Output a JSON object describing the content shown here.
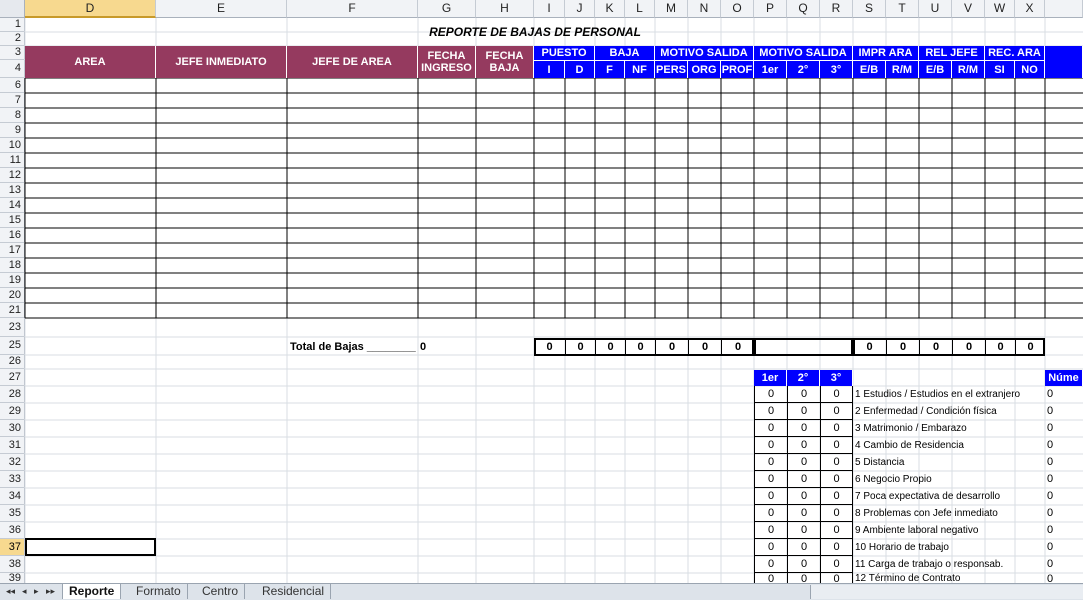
{
  "report_title": "REPORTE DE BAJAS DE PERSONAL",
  "columns": [
    "D",
    "E",
    "F",
    "G",
    "H",
    "I",
    "J",
    "K",
    "L",
    "M",
    "N",
    "O",
    "P",
    "Q",
    "R",
    "S",
    "T",
    "U",
    "V",
    "W",
    "X"
  ],
  "selected_column": "D",
  "rows": [
    "1",
    "2",
    "3",
    "4",
    "6",
    "7",
    "8",
    "9",
    "10",
    "11",
    "12",
    "13",
    "14",
    "15",
    "16",
    "17",
    "18",
    "19",
    "20",
    "21",
    "23",
    "25",
    "26",
    "27",
    "28",
    "29",
    "30",
    "31",
    "32",
    "33",
    "34",
    "35",
    "36",
    "37",
    "38",
    "39"
  ],
  "selected_row": "37",
  "headers": {
    "area": "AREA",
    "jefe_inmediato": "JEFE INMEDIATO",
    "jefe_de_area": "JEFE DE AREA",
    "fecha_ingreso": "FECHA INGRESO",
    "fecha_baja": "FECHA BAJA",
    "puesto": "PUESTO",
    "puesto_sub": [
      "I",
      "D"
    ],
    "baja": "BAJA",
    "baja_sub": [
      "F",
      "NF"
    ],
    "motivo_salida_1": "MOTIVO SALIDA",
    "motivo_salida_1_sub": [
      "PERS",
      "ORG",
      "PROF"
    ],
    "motivo_salida_2": "MOTIVO SALIDA",
    "motivo_salida_2_sub": [
      "1er",
      "2°",
      "3°"
    ],
    "impr_ara": "IMPR  ARA",
    "impr_ara_sub": [
      "E/B",
      "R/M"
    ],
    "rel_jefe": "REL JEFE",
    "rel_jefe_sub": [
      "E/B",
      "R/M"
    ],
    "rec_ara": "REC. ARA",
    "rec_ara_sub": [
      "SI",
      "NO"
    ]
  },
  "totals": {
    "label": "Total de Bajas ________",
    "value": "0",
    "box1": [
      "0",
      "0",
      "0",
      "0",
      "0",
      "0",
      "0"
    ],
    "box2": [
      "0",
      "0",
      "0",
      "0",
      "0",
      "0"
    ]
  },
  "reason_table": {
    "headers": [
      "1er",
      "2°",
      "3°"
    ],
    "right_header": "Núme",
    "rows": [
      {
        "n1": "0",
        "n2": "0",
        "n3": "0",
        "label": "1 Estudios / Estudios en el extranjero",
        "count": "0"
      },
      {
        "n1": "0",
        "n2": "0",
        "n3": "0",
        "label": "2 Enfermedad / Condición física",
        "count": "0"
      },
      {
        "n1": "0",
        "n2": "0",
        "n3": "0",
        "label": "3 Matrimonio / Embarazo",
        "count": "0"
      },
      {
        "n1": "0",
        "n2": "0",
        "n3": "0",
        "label": "4 Cambio de Residencia",
        "count": "0"
      },
      {
        "n1": "0",
        "n2": "0",
        "n3": "0",
        "label": "5 Distancia",
        "count": "0"
      },
      {
        "n1": "0",
        "n2": "0",
        "n3": "0",
        "label": "6 Negocio Propio",
        "count": "0"
      },
      {
        "n1": "0",
        "n2": "0",
        "n3": "0",
        "label": "7 Poca expectativa de desarrollo",
        "count": "0"
      },
      {
        "n1": "0",
        "n2": "0",
        "n3": "0",
        "label": "8 Problemas con Jefe inmediato",
        "count": "0"
      },
      {
        "n1": "0",
        "n2": "0",
        "n3": "0",
        "label": "9 Ambiente laboral negativo",
        "count": "0"
      },
      {
        "n1": "0",
        "n2": "0",
        "n3": "0",
        "label": "10 Horario de trabajo",
        "count": "0"
      },
      {
        "n1": "0",
        "n2": "0",
        "n3": "0",
        "label": "11 Carga de trabajo o responsab.",
        "count": "0"
      },
      {
        "n1": "0",
        "n2": "0",
        "n3": "0",
        "label": "12 Término de Contrato",
        "count": "0"
      }
    ]
  },
  "sheet_tabs": [
    "Reporte",
    "Formato",
    "Centro",
    "Residencial"
  ],
  "active_tab": "Reporte",
  "tab_nav": [
    "◂◂",
    "◂",
    "▸",
    "▸▸"
  ]
}
